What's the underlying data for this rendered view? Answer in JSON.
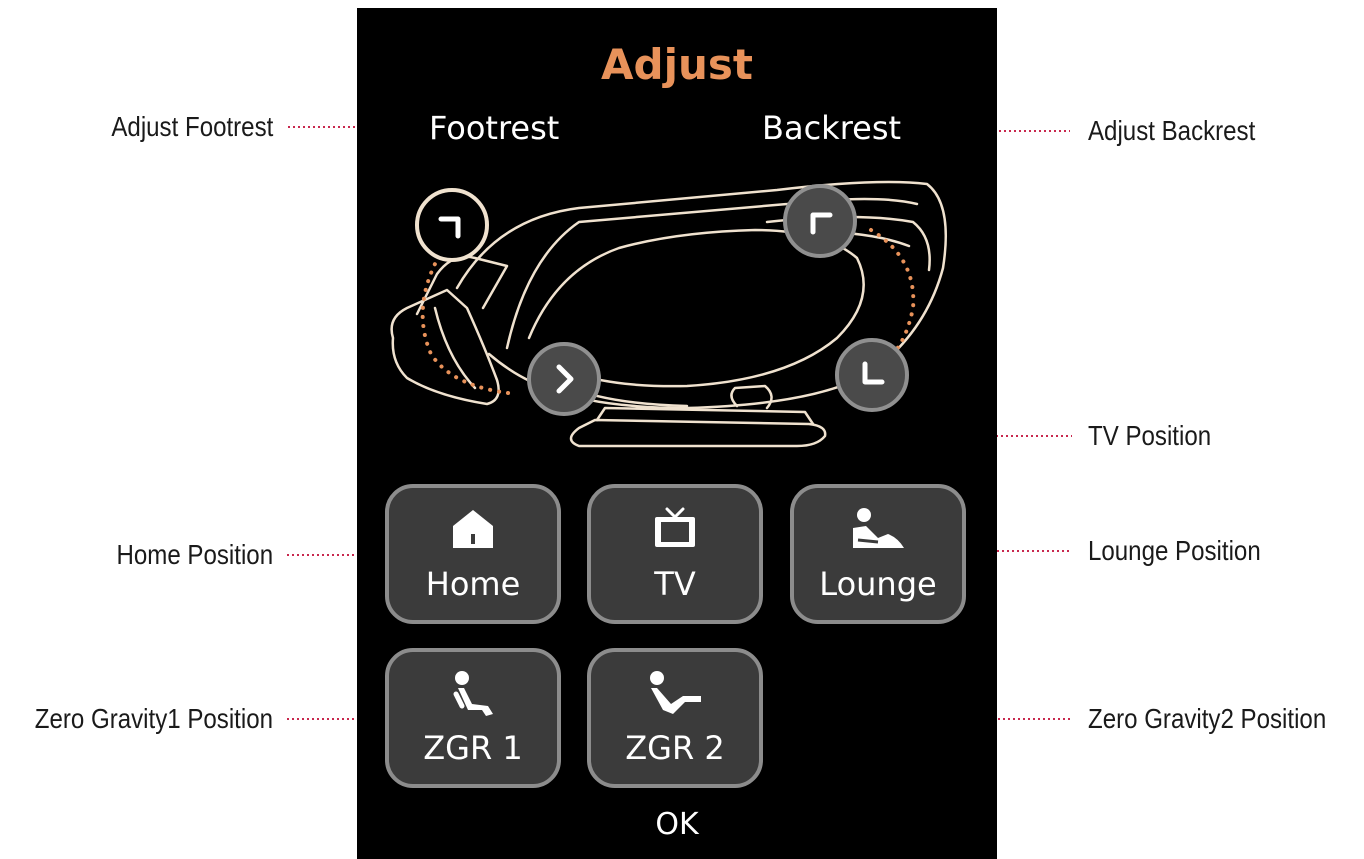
{
  "screen": {
    "title": "Adjust",
    "footrest_label": "Footrest",
    "backrest_label": "Backrest",
    "ok_label": "OK"
  },
  "adjust_controls": [
    {
      "name": "footrest-raise-button",
      "icon": "footrest-up-chevron-icon"
    },
    {
      "name": "footrest-lower-button",
      "icon": "footrest-down-chevron-icon"
    },
    {
      "name": "backrest-raise-button",
      "icon": "backrest-up-chevron-icon"
    },
    {
      "name": "backrest-recline-button",
      "icon": "backrest-down-chevron-icon"
    }
  ],
  "positions": {
    "home": {
      "label": "Home",
      "icon": "house-icon"
    },
    "tv": {
      "label": "TV",
      "icon": "tv-icon"
    },
    "lounge": {
      "label": "Lounge",
      "icon": "reclining-person-icon"
    },
    "zgr1": {
      "label": "ZGR 1",
      "icon": "seated-person-icon"
    },
    "zgr2": {
      "label": "ZGR 2",
      "icon": "reclined-person-icon"
    }
  },
  "callouts": {
    "adjust_footrest": "Adjust Footrest",
    "adjust_backrest": "Adjust Backrest",
    "tv_position": "TV Position",
    "home_position": "Home Position",
    "lounge_position": "Lounge Position",
    "zero_gravity1_position": "Zero Gravity1 Position",
    "zero_gravity2_position": "Zero Gravity2 Position"
  },
  "colors": {
    "panel_background": "#000000",
    "title_accent": "#e8925a",
    "chair_outline": "#f0e2cf",
    "button_fill": "#3b3b3b",
    "button_border": "#8c8c8c",
    "leader_line": "#c8284e"
  }
}
